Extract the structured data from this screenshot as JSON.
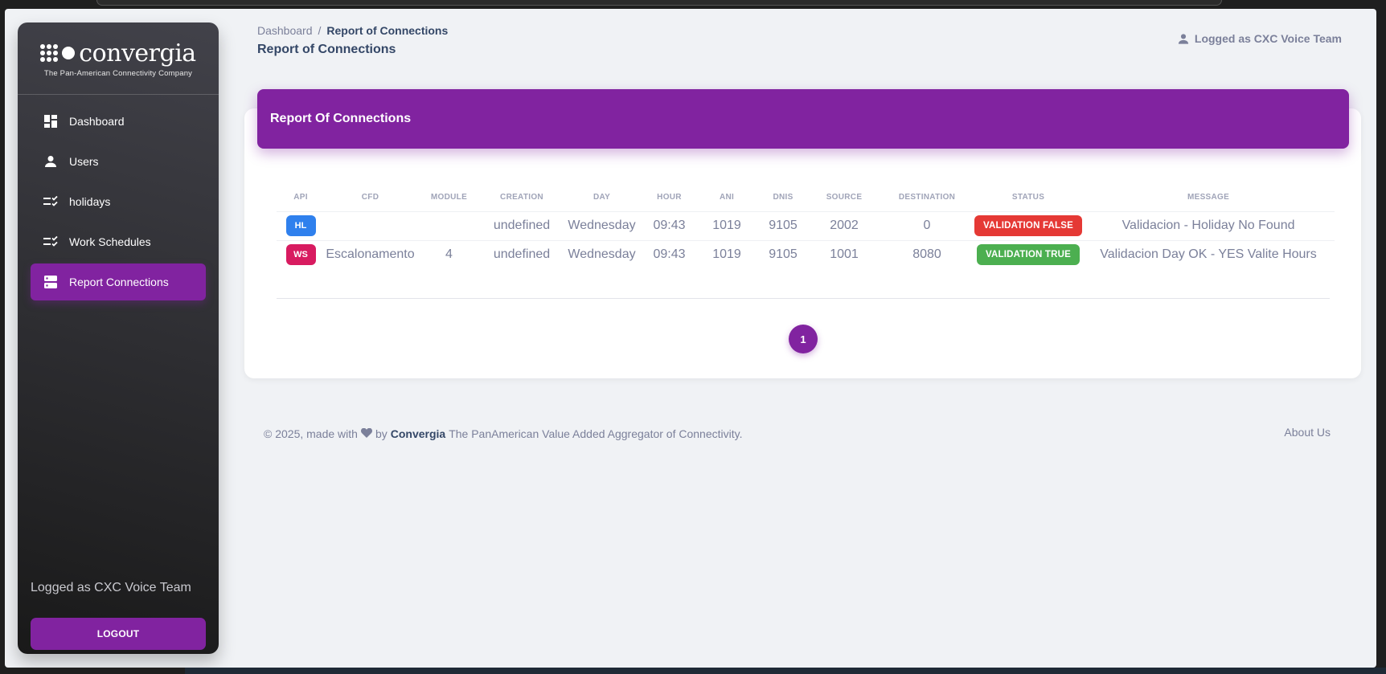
{
  "app": {
    "logo_word": "convergia",
    "logo_tagline": "The Pan-American Connectivity Company"
  },
  "sidebar": {
    "items": [
      {
        "label": "Dashboard",
        "icon": "dashboard-icon"
      },
      {
        "label": "Users",
        "icon": "user-icon"
      },
      {
        "label": "holidays",
        "icon": "checklist-icon"
      },
      {
        "label": "Work Schedules",
        "icon": "checklist-icon"
      },
      {
        "label": "Report Connections",
        "icon": "storage-icon",
        "active": true
      }
    ],
    "user_text": "Logged as CXC Voice Team",
    "logout_label": "LOGOUT"
  },
  "header": {
    "breadcrumb_root": "Dashboard",
    "breadcrumb_sep": "/",
    "breadcrumb_current": "Report of Connections",
    "title": "Report of Connections",
    "user_text": "Logged as CXC Voice Team"
  },
  "card": {
    "title": "Report Of Connections",
    "columns": [
      "API",
      "CFD",
      "MODULE",
      "CREATION",
      "DAY",
      "HOUR",
      "ANI",
      "DNIS",
      "SOURCE",
      "DESTINATION",
      "STATUS",
      "MESSAGE"
    ],
    "rows": [
      {
        "api": "HL",
        "api_color": "#2f80ed",
        "cfd": "",
        "module": "",
        "creation": "undefined",
        "day": "Wednesday",
        "hour": "09:43",
        "ani": "1019",
        "dnis": "9105",
        "source": "2002",
        "destination": "0",
        "status": "VALIDATION FALSE",
        "status_color": "#e53935",
        "message": "Validacion - Holiday No Found"
      },
      {
        "api": "WS",
        "api_color": "#d81b60",
        "cfd": "Escalonamento",
        "module": "4",
        "creation": "undefined",
        "day": "Wednesday",
        "hour": "09:43",
        "ani": "1019",
        "dnis": "9105",
        "source": "1001",
        "destination": "8080",
        "status": "VALIDATION TRUE",
        "status_color": "#4caf50",
        "message": "Validacion Day OK - YES Valite Hours"
      }
    ],
    "pagination": {
      "current": "1"
    }
  },
  "footer": {
    "prefix": "© 2025, made with",
    "by": "by",
    "brand": "Convergia",
    "suffix": "The PanAmerican Value Added Aggregator of Connectivity.",
    "about": "About Us"
  },
  "colors": {
    "accent": "#8123a0",
    "text_dark": "#344767",
    "text_muted": "#7b809a"
  }
}
